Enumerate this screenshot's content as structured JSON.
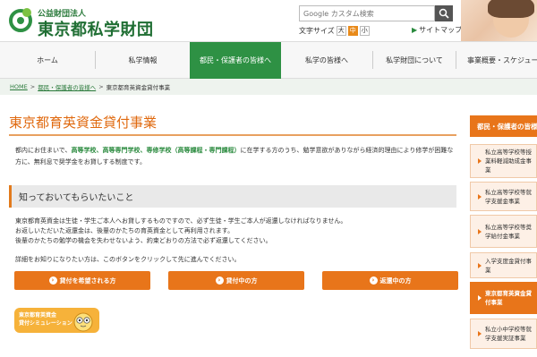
{
  "header": {
    "org_sub": "公益財団法人",
    "org_name": "東京都私学財団",
    "search_placeholder": "Google カスタム検索",
    "font_size_label": "文字サイズ",
    "font_sizes": [
      "大",
      "中",
      "小"
    ],
    "font_size_active": "中",
    "sitemap_label": "サイトマップ"
  },
  "nav": {
    "items": [
      {
        "label": "ホーム"
      },
      {
        "label": "私学情報"
      },
      {
        "label": "都民・保護者の皆様へ"
      },
      {
        "label": "私学の皆様へ"
      },
      {
        "label": "私学財団について"
      },
      {
        "label": "事業概要・スケジュール"
      }
    ],
    "active_index": 2
  },
  "breadcrumb": {
    "home": "HOME",
    "parent": "都民・保護者の皆様へ",
    "current": "東京都育英資金貸付事業",
    "sep": ">"
  },
  "main": {
    "title": "東京都育英資金貸付事業",
    "intro_pre": "都内にお住まいで、",
    "intro_highlight": "高等学校、高等専門学校、専修学校（高等課程・専門課程）",
    "intro_post": "に在学する方のうち、勉学意欲がありながら経済的理由により修学が困難な方に、無利息で奨学金をお貸しする制度です。",
    "section_heading": "知っておいてもらいたいこと",
    "body_lines": [
      "東京都育英資金は生徒・学生ご本人へお貸しするものですので、必ず生徒・学生ご本人が返還しなければなりません。",
      "お返しいただいた返還金は、後輩のかたちの育英資金として再利用されます。",
      "後輩のかたちの勉学の機会を失わせないよう、約束どおりの方法で必ず返還してください。"
    ],
    "detail_text": "詳細をお知りになりたい方は、このボタンをクリックして先に進んでください。",
    "buttons": [
      "貸付を希望される方",
      "貸付中の方",
      "返還中の方"
    ],
    "sim_label_line1": "東京都育英資金",
    "sim_label_line2": "貸付シミュレーション"
  },
  "sidebar": {
    "heading": "都民・保護者の皆様へ",
    "items": [
      {
        "label": "私立高等学校等授業料軽減助成金事業"
      },
      {
        "label": "私立高等学校等就学支援金事業"
      },
      {
        "label": "私立高等学校等奨学給付金事業"
      },
      {
        "label": "入学支度金貸付事業"
      },
      {
        "label": "東京都育英資金貸付事業"
      },
      {
        "label": "私立小中学校等就学支援実証事業"
      }
    ],
    "active_index": 4
  },
  "colors": {
    "brand_green": "#2e9144",
    "accent_orange": "#e8751a",
    "title_orange": "#e06a10"
  }
}
